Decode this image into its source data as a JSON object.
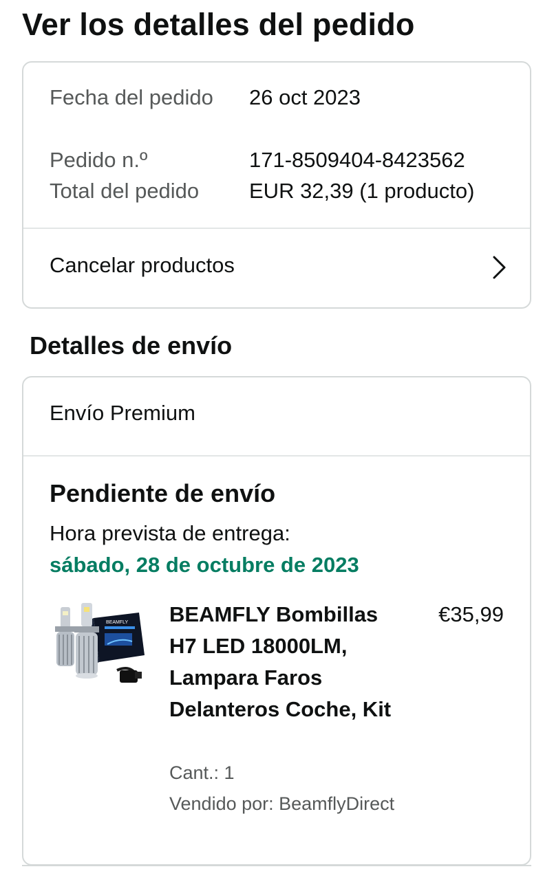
{
  "page": {
    "title": "Ver los detalles del pedido"
  },
  "order_summary": {
    "rows": [
      {
        "label": "Fecha del pedido",
        "value": "26 oct 2023"
      },
      {
        "label": "Pedido n.º",
        "value": "171-8509404-8423562"
      },
      {
        "label": "Total del pedido",
        "value": "EUR 32,39 (1 producto)"
      }
    ],
    "cancel_label": "Cancelar productos",
    "cancel_icon": "chevron-right-icon"
  },
  "shipping": {
    "section_title": "Detalles de envío",
    "method": "Envío Premium",
    "status": "Pendiente de envío",
    "eta_label": "Hora prevista de entrega:",
    "eta_date": "sábado, 28 de octubre de 2023",
    "eta_color": "#067d62"
  },
  "product": {
    "title": "BEAMFLY Bombillas H7 LED 18000LM, Lampara Faros Delanteros Coche, Kit",
    "price": "€35,99",
    "quantity": "Cant.: 1",
    "seller": "Vendido por: BeamflyDirect",
    "image": "led-headlight-bulbs-product-image"
  }
}
